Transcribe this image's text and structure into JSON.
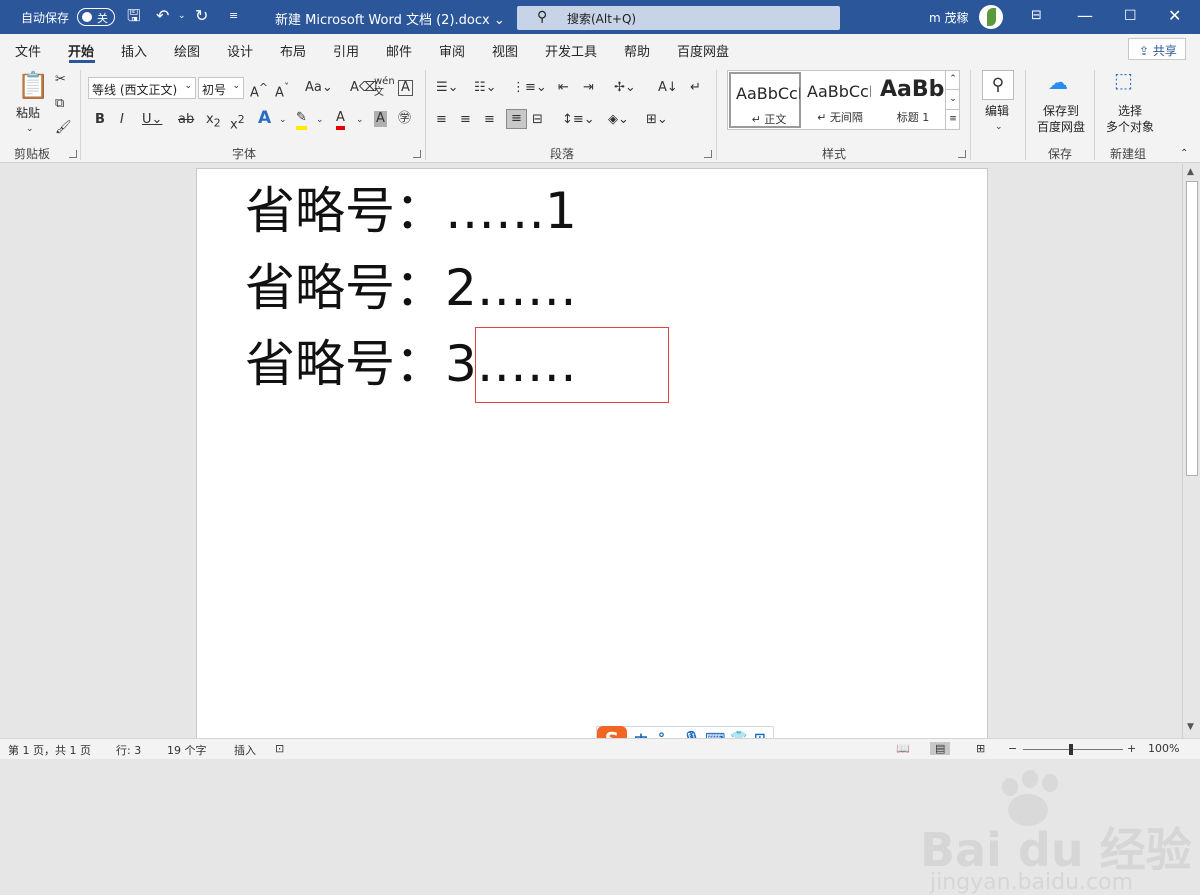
{
  "titlebar": {
    "autosave_label": "自动保存",
    "autosave_state": "关",
    "doc_title": "新建 Microsoft Word 文档 (2).docx",
    "search_placeholder": "搜索(Alt+Q)",
    "user_name": "m 茂稼"
  },
  "menu": {
    "tabs": [
      "文件",
      "开始",
      "插入",
      "绘图",
      "设计",
      "布局",
      "引用",
      "邮件",
      "审阅",
      "视图",
      "开发工具",
      "帮助",
      "百度网盘"
    ],
    "active": "开始",
    "share": "共享"
  },
  "ribbon": {
    "clipboard": {
      "paste": "粘贴",
      "group": "剪贴板"
    },
    "font": {
      "name": "等线 (西文正文)",
      "size": "初号",
      "group": "字体"
    },
    "paragraph": {
      "group": "段落"
    },
    "styles": {
      "group": "样式",
      "items": [
        {
          "preview": "AaBbCcD",
          "name": "↵ 正文"
        },
        {
          "preview": "AaBbCcD",
          "name": "↵ 无间隔"
        },
        {
          "preview": "AaBb",
          "name": "标题 1"
        }
      ]
    },
    "edit": {
      "label": "编辑"
    },
    "save": {
      "line1": "保存到",
      "line2": "百度网盘",
      "group": "保存"
    },
    "select": {
      "line1": "选择",
      "line2": "多个对象",
      "group": "新建组"
    }
  },
  "document": {
    "lines": [
      "省略号：……1",
      "省略号：2……",
      "省略号：3……"
    ]
  },
  "ime": {
    "mode": "中",
    "punct": "°,"
  },
  "watermark": {
    "brand": "Bai du 经验",
    "url": "jingyan.baidu.com"
  },
  "status": {
    "page": "第 1 页，共 1 页",
    "line": "行: 3",
    "words": "19 个字",
    "insert": "插入",
    "zoom": "100%"
  }
}
